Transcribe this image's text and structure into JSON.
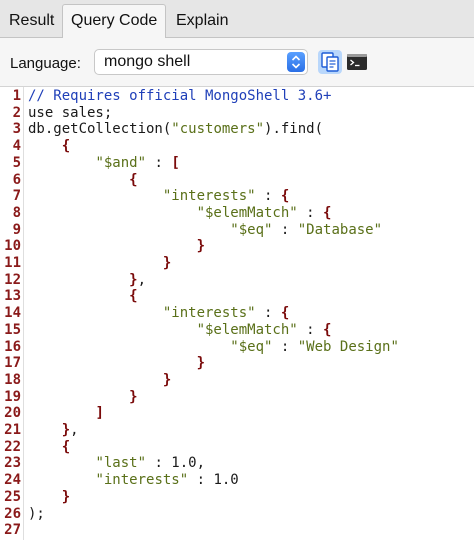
{
  "tabs": [
    {
      "label": "Result",
      "active": false
    },
    {
      "label": "Query Code",
      "active": true
    },
    {
      "label": "Explain",
      "active": false
    }
  ],
  "toolbar": {
    "language_label": "Language:",
    "language_value": "mongo shell",
    "copy_icon": "copy-document-icon",
    "shell_icon": "terminal-icon"
  },
  "colors": {
    "comment": "#1f3fb8",
    "string": "#5a7019",
    "bracket": "#7a0a0a",
    "line_number": "#8a1a1a",
    "select_stepper": "#2a6fe6"
  },
  "code_lines": [
    {
      "n": "1",
      "tokens": [
        {
          "t": "// Requires official MongoShell 3.6+",
          "c": "cm"
        }
      ]
    },
    {
      "n": "2",
      "tokens": [
        {
          "t": "use sales;",
          "c": "nm"
        }
      ]
    },
    {
      "n": "3",
      "tokens": [
        {
          "t": "db.getCollection(",
          "c": "nm"
        },
        {
          "t": "\"customers\"",
          "c": "st"
        },
        {
          "t": ").find(",
          "c": "nm"
        }
      ]
    },
    {
      "n": "4",
      "tokens": [
        {
          "t": "    ",
          "c": "nm"
        },
        {
          "t": "{",
          "c": "br"
        }
      ]
    },
    {
      "n": "5",
      "tokens": [
        {
          "t": "        ",
          "c": "nm"
        },
        {
          "t": "\"$and\"",
          "c": "st"
        },
        {
          "t": " : ",
          "c": "nm"
        },
        {
          "t": "[",
          "c": "br"
        }
      ]
    },
    {
      "n": "6",
      "tokens": [
        {
          "t": "            ",
          "c": "nm"
        },
        {
          "t": "{",
          "c": "br"
        }
      ]
    },
    {
      "n": "7",
      "tokens": [
        {
          "t": "                ",
          "c": "nm"
        },
        {
          "t": "\"interests\"",
          "c": "st"
        },
        {
          "t": " : ",
          "c": "nm"
        },
        {
          "t": "{",
          "c": "br"
        }
      ]
    },
    {
      "n": "8",
      "tokens": [
        {
          "t": "                    ",
          "c": "nm"
        },
        {
          "t": "\"$elemMatch\"",
          "c": "st"
        },
        {
          "t": " : ",
          "c": "nm"
        },
        {
          "t": "{",
          "c": "br"
        }
      ]
    },
    {
      "n": "9",
      "tokens": [
        {
          "t": "                        ",
          "c": "nm"
        },
        {
          "t": "\"$eq\"",
          "c": "st"
        },
        {
          "t": " : ",
          "c": "nm"
        },
        {
          "t": "\"Database\"",
          "c": "st"
        }
      ]
    },
    {
      "n": "10",
      "tokens": [
        {
          "t": "                    ",
          "c": "nm"
        },
        {
          "t": "}",
          "c": "br"
        }
      ]
    },
    {
      "n": "11",
      "tokens": [
        {
          "t": "                ",
          "c": "nm"
        },
        {
          "t": "}",
          "c": "br"
        }
      ]
    },
    {
      "n": "12",
      "tokens": [
        {
          "t": "            ",
          "c": "nm"
        },
        {
          "t": "}",
          "c": "br"
        },
        {
          "t": ",",
          "c": "nm"
        }
      ]
    },
    {
      "n": "13",
      "tokens": [
        {
          "t": "            ",
          "c": "nm"
        },
        {
          "t": "{",
          "c": "br"
        }
      ]
    },
    {
      "n": "14",
      "tokens": [
        {
          "t": "                ",
          "c": "nm"
        },
        {
          "t": "\"interests\"",
          "c": "st"
        },
        {
          "t": " : ",
          "c": "nm"
        },
        {
          "t": "{",
          "c": "br"
        }
      ]
    },
    {
      "n": "15",
      "tokens": [
        {
          "t": "                    ",
          "c": "nm"
        },
        {
          "t": "\"$elemMatch\"",
          "c": "st"
        },
        {
          "t": " : ",
          "c": "nm"
        },
        {
          "t": "{",
          "c": "br"
        }
      ]
    },
    {
      "n": "16",
      "tokens": [
        {
          "t": "                        ",
          "c": "nm"
        },
        {
          "t": "\"$eq\"",
          "c": "st"
        },
        {
          "t": " : ",
          "c": "nm"
        },
        {
          "t": "\"Web Design\"",
          "c": "st"
        }
      ]
    },
    {
      "n": "17",
      "tokens": [
        {
          "t": "                    ",
          "c": "nm"
        },
        {
          "t": "}",
          "c": "br"
        }
      ]
    },
    {
      "n": "18",
      "tokens": [
        {
          "t": "                ",
          "c": "nm"
        },
        {
          "t": "}",
          "c": "br"
        }
      ]
    },
    {
      "n": "19",
      "tokens": [
        {
          "t": "            ",
          "c": "nm"
        },
        {
          "t": "}",
          "c": "br"
        }
      ]
    },
    {
      "n": "20",
      "tokens": [
        {
          "t": "        ",
          "c": "nm"
        },
        {
          "t": "]",
          "c": "br"
        }
      ]
    },
    {
      "n": "21",
      "tokens": [
        {
          "t": "    ",
          "c": "nm"
        },
        {
          "t": "}",
          "c": "br"
        },
        {
          "t": ",",
          "c": "nm"
        }
      ]
    },
    {
      "n": "22",
      "tokens": [
        {
          "t": "    ",
          "c": "nm"
        },
        {
          "t": "{",
          "c": "br"
        }
      ]
    },
    {
      "n": "23",
      "tokens": [
        {
          "t": "        ",
          "c": "nm"
        },
        {
          "t": "\"last\"",
          "c": "st"
        },
        {
          "t": " : 1.0,",
          "c": "nm"
        }
      ]
    },
    {
      "n": "24",
      "tokens": [
        {
          "t": "        ",
          "c": "nm"
        },
        {
          "t": "\"interests\"",
          "c": "st"
        },
        {
          "t": " : 1.0",
          "c": "nm"
        }
      ]
    },
    {
      "n": "25",
      "tokens": [
        {
          "t": "    ",
          "c": "nm"
        },
        {
          "t": "}",
          "c": "br"
        }
      ]
    },
    {
      "n": "26",
      "tokens": [
        {
          "t": ");",
          "c": "nm"
        }
      ]
    },
    {
      "n": "27",
      "tokens": []
    }
  ]
}
